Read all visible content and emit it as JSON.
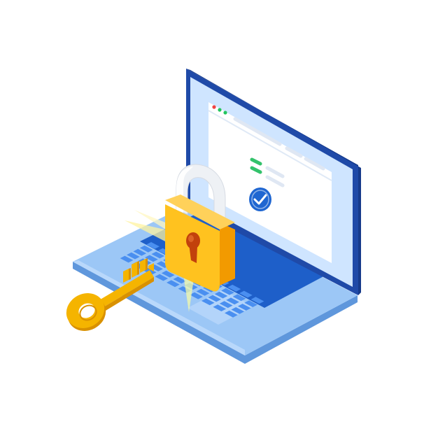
{
  "illustration": {
    "subject": "laptop-with-padlock-and-key",
    "icons": [
      "laptop-icon",
      "padlock-icon",
      "key-icon",
      "checkmark-icon"
    ],
    "colors": {
      "background": "#ffffff",
      "screen_frame": "#1f4aa8",
      "screen_bezel": "#d6e9ff",
      "screen_content": "#ffffff",
      "laptop_base": "#8dbdf3",
      "laptop_base_dark": "#5f97dc",
      "keyboard": "#2a6bd6",
      "lock_body": "#ffc21f",
      "lock_body_shade": "#f29a00",
      "lock_shackle": "#e9edf2",
      "keyhole": "#c2410c",
      "key": "#f5b400",
      "check_badge": "#1f66d1",
      "green_bars": "#33c26b",
      "window_dot_red": "#ef4444",
      "window_dot_green": "#22c55e"
    }
  }
}
